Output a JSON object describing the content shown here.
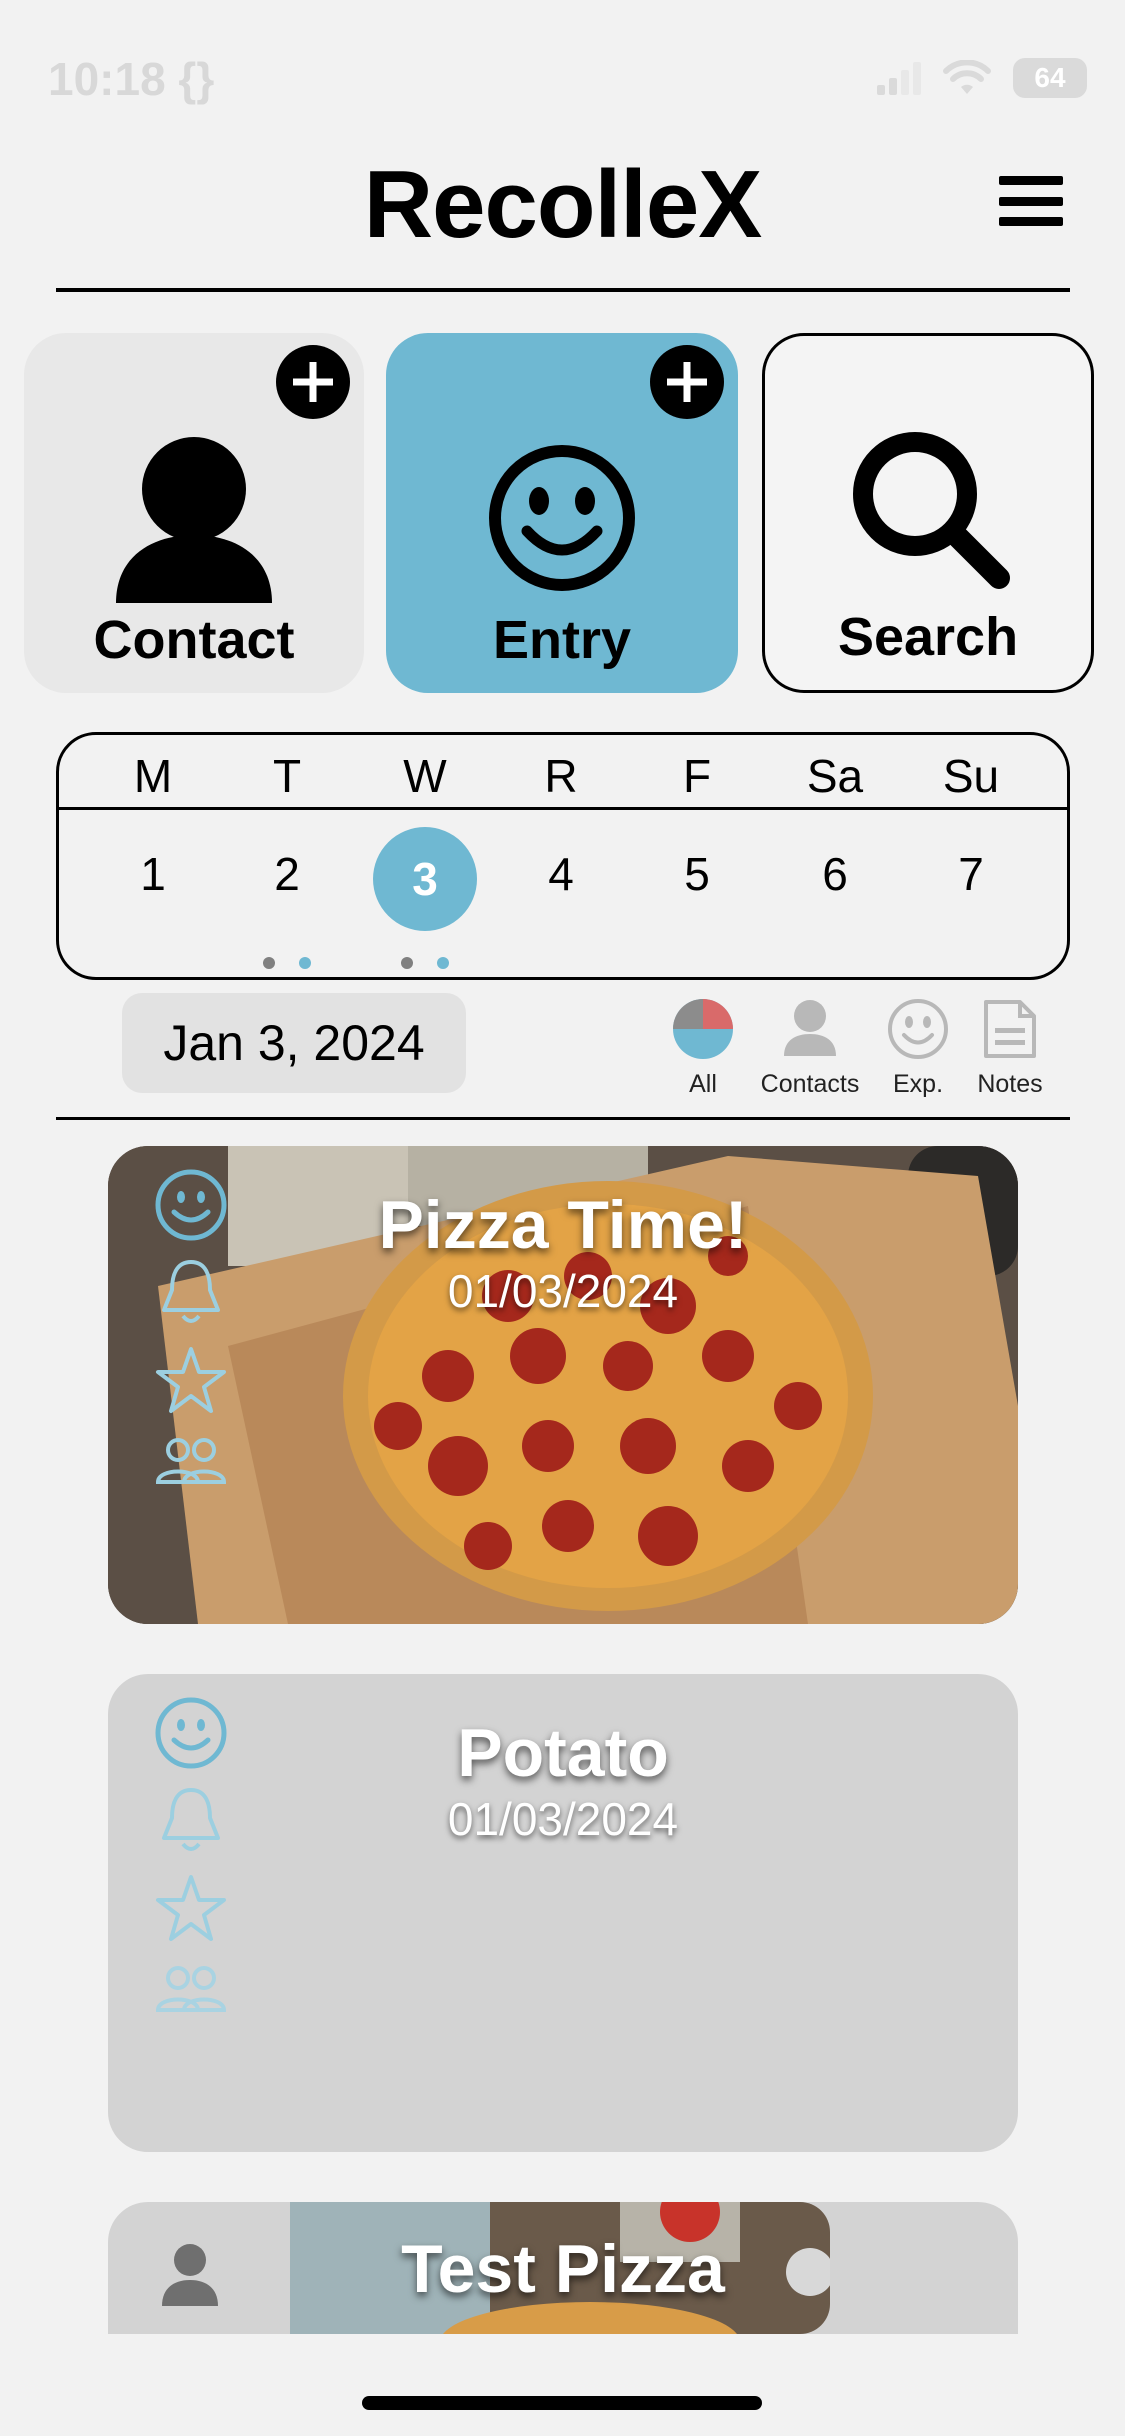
{
  "status_bar": {
    "time": "10:18 {}",
    "battery": "64"
  },
  "header": {
    "title": "RecolleX",
    "menu_icon": "hamburger-menu-icon"
  },
  "tiles": [
    {
      "label": "Contact",
      "icon": "person-icon",
      "has_add": true
    },
    {
      "label": "Entry",
      "icon": "smiley-icon",
      "has_add": true,
      "highlight_color": "#6fb8d2"
    },
    {
      "label": "Search",
      "icon": "magnifier-icon",
      "has_add": false
    }
  ],
  "week": {
    "days": [
      {
        "name": "M",
        "num": "1"
      },
      {
        "name": "T",
        "num": "2"
      },
      {
        "name": "W",
        "num": "3"
      },
      {
        "name": "R",
        "num": "4"
      },
      {
        "name": "F",
        "num": "5"
      },
      {
        "name": "Sa",
        "num": "6"
      },
      {
        "name": "Su",
        "num": "7"
      }
    ],
    "selected_day": "3",
    "accent": "#6fb8d2"
  },
  "selected_date": "Jan 3, 2024",
  "filters": [
    {
      "label": "All",
      "icon": "pie-icon"
    },
    {
      "label": "Contacts",
      "icon": "person-icon"
    },
    {
      "label": "Exp.",
      "icon": "smiley-icon"
    },
    {
      "label": "Notes",
      "icon": "note-icon"
    }
  ],
  "entries": [
    {
      "title": "Pizza Time!",
      "date": "01/03/2024",
      "has_photo": true
    },
    {
      "title": "Potato",
      "date": "01/03/2024",
      "has_photo": false
    },
    {
      "title": "Test Pizza",
      "date": "",
      "has_photo": true
    }
  ]
}
